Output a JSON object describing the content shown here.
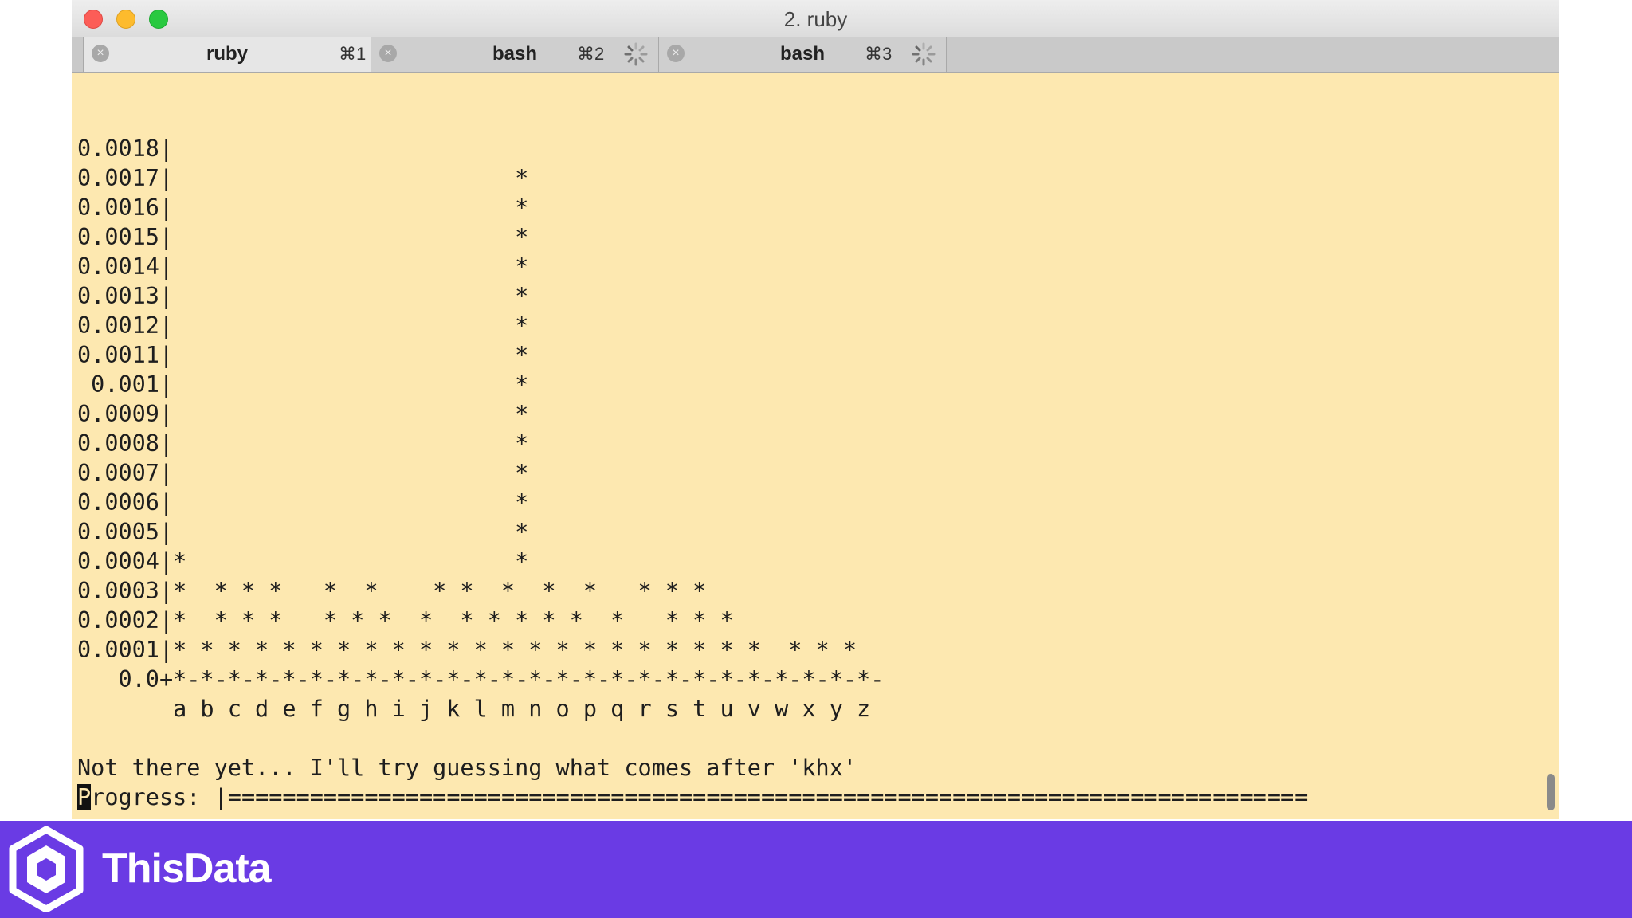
{
  "window": {
    "title": "2. ruby"
  },
  "tabs": [
    {
      "label": "ruby",
      "shortcut": "⌘1",
      "busy": false
    },
    {
      "label": "bash",
      "shortcut": "⌘2",
      "busy": true
    },
    {
      "label": "bash",
      "shortcut": "⌘3",
      "busy": true
    }
  ],
  "terminal": {
    "chart_lines": [
      "0.0018|",
      "0.0017|                         *",
      "0.0016|                         *",
      "0.0015|                         *",
      "0.0014|                         *",
      "0.0013|                         *",
      "0.0012|                         *",
      "0.0011|                         *",
      " 0.001|                         *",
      "0.0009|                         *",
      "0.0008|                         *",
      "0.0007|                         *",
      "0.0006|                         *",
      "0.0005|                         *",
      "0.0004|*                        *",
      "0.0003|*  * * *   *  *    * *  *  *  *   * * *",
      "0.0002|*  * * *   * * *  *  * * * * *  *   * * *",
      "0.0001|* * * * * * * * * * * * * * * * * * * * * *  * * *",
      "   0.0+*-*-*-*-*-*-*-*-*-*-*-*-*-*-*-*-*-*-*-*-*-*-*-*-*-*-",
      "       a b c d e f g h i j k l m n o p q r s t u v w x y z"
    ],
    "message": "Not there yet... I'll try guessing what comes after 'khx'",
    "progress_label": "Progress:",
    "progress_bar": "|==============================================================================="
  },
  "footer": {
    "brand": "ThisData",
    "background": "#6a3be4"
  }
}
